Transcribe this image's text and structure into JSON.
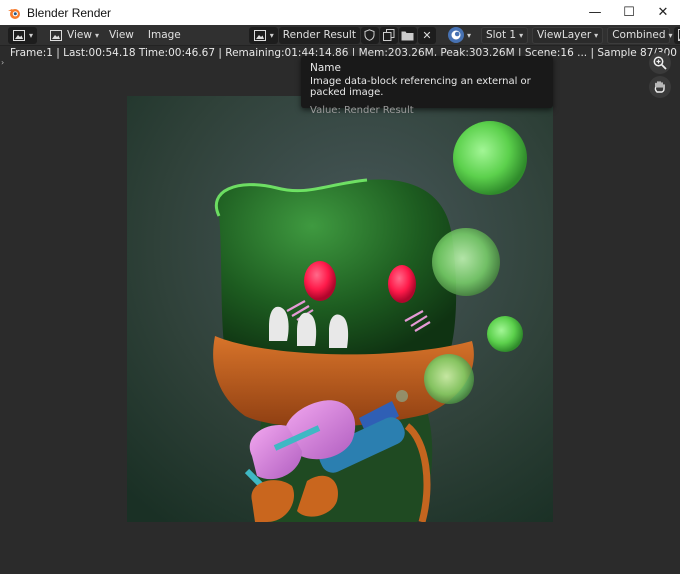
{
  "window": {
    "title": "Blender Render",
    "minimize": "—",
    "maximize": "☐",
    "close": "✕"
  },
  "header": {
    "view_menu": "View",
    "view_label": "View",
    "image_label": "Image",
    "image_name": "Render Result",
    "slot": "Slot 1",
    "view_layer": "ViewLayer",
    "pass": "Combined"
  },
  "info_line": "Frame:1 | Last:00:54.18 Time:00:46.67 | Remaining:01:44:14.86 | Mem",
  "info_line_obscured": ":203.26M, Peak:303.26M | Scene:16 ... | Sample 87/300",
  "tooltip": {
    "title": "Name",
    "description": "Image data-block referencing an external or packed image.",
    "value": "Value: Render Result"
  },
  "colors": {
    "header_bg": "#303030",
    "area_bg": "#2b2b2b",
    "accent_blue": "#4772b3"
  },
  "icons": {
    "blender_logo": "blender-logo-icon",
    "zoom": "zoom-icon",
    "hand": "hand-pan-icon"
  }
}
